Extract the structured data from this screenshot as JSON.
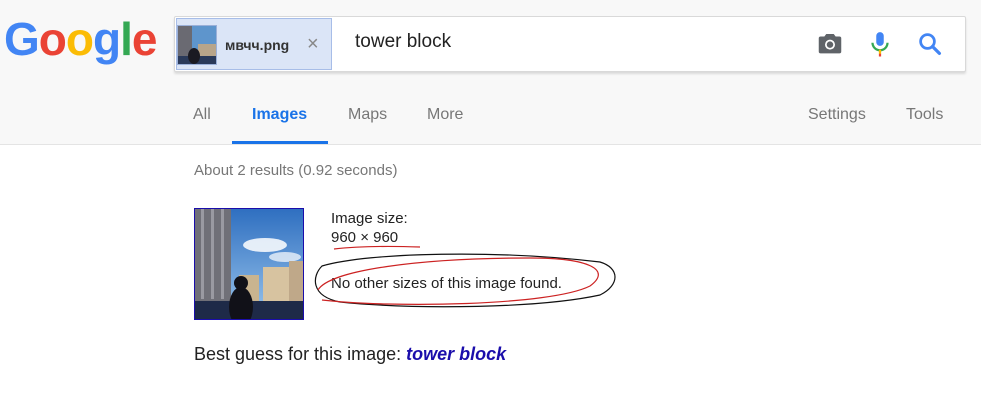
{
  "logo": {
    "letters": [
      "G",
      "o",
      "o",
      "g",
      "l",
      "e"
    ],
    "colors": [
      "#4285f4",
      "#ea4335",
      "#fbbc05",
      "#4285f4",
      "#34a853",
      "#ea4335"
    ]
  },
  "search": {
    "chip_filename": "мвчч.png",
    "chip_close": "×",
    "query": "tower block",
    "icons": [
      "camera-icon",
      "microphone-icon",
      "search-icon"
    ]
  },
  "tabs": {
    "items": [
      {
        "label": "All"
      },
      {
        "label": "Images",
        "active": true
      },
      {
        "label": "Maps"
      },
      {
        "label": "More"
      }
    ],
    "right": [
      {
        "label": "Settings"
      },
      {
        "label": "Tools"
      }
    ],
    "accent_color": "#1a73e8"
  },
  "results": {
    "stats": "About 2 results (0.92 seconds)",
    "image_size_label": "Image size:",
    "image_size_value": "960 × 960",
    "no_sizes_text": "No other sizes of this image found.",
    "best_guess_label": "Best guess for this image:",
    "best_guess_query": "tower block",
    "link_color": "#1a0dab"
  }
}
